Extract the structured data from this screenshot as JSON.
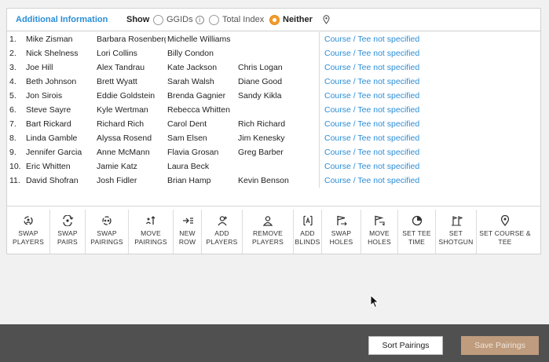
{
  "header": {
    "title": "Additional Information",
    "show_label": "Show",
    "options": [
      {
        "label": "GGIDs",
        "checked": false
      },
      {
        "label": "Total Index",
        "checked": false
      },
      {
        "label": "Neither",
        "checked": true
      }
    ]
  },
  "pairings": [
    {
      "num": "1.",
      "p1": "Mike Zisman",
      "p2": "Barbara Rosenberg",
      "p3": "Michelle Williams",
      "p4": "",
      "course": "Course / Tee not specified"
    },
    {
      "num": "2.",
      "p1": "Nick Shelness",
      "p2": "Lori Collins",
      "p3": "Billy Condon",
      "p4": "",
      "course": "Course / Tee not specified"
    },
    {
      "num": "3.",
      "p1": "Joe Hill",
      "p2": "Alex Tandrau",
      "p3": "Kate Jackson",
      "p4": "Chris Logan",
      "course": "Course / Tee not specified"
    },
    {
      "num": "4.",
      "p1": "Beth Johnson",
      "p2": "Brett Wyatt",
      "p3": "Sarah Walsh",
      "p4": "Diane Good",
      "course": "Course / Tee not specified"
    },
    {
      "num": "5.",
      "p1": "Jon Sirois",
      "p2": "Eddie Goldstein",
      "p3": "Brenda Gagnier",
      "p4": "Sandy Kikla",
      "course": "Course / Tee not specified"
    },
    {
      "num": "6.",
      "p1": "Steve Sayre",
      "p2": "Kyle Wertman",
      "p3": "Rebecca Whitten",
      "p4": "",
      "course": "Course / Tee not specified"
    },
    {
      "num": "7.",
      "p1": "Bart Rickard",
      "p2": "Richard Rich",
      "p3": "Carol Dent",
      "p4": "Rich Richard",
      "course": "Course / Tee not specified"
    },
    {
      "num": "8.",
      "p1": "Linda Gamble",
      "p2": "Alyssa Rosend",
      "p3": "Sam Elsen",
      "p4": "Jim Kenesky",
      "course": "Course / Tee not specified"
    },
    {
      "num": "9.",
      "p1": "Jennifer Garcia",
      "p2": "Anne McMann",
      "p3": "Flavia Grosan",
      "p4": "Greg Barber",
      "course": "Course / Tee not specified"
    },
    {
      "num": "10.",
      "p1": "Eric Whitten",
      "p2": "Jamie Katz",
      "p3": "Laura Beck",
      "p4": "",
      "course": "Course / Tee not specified"
    },
    {
      "num": "11.",
      "p1": "David Shofran",
      "p2": "Josh Fidler",
      "p3": "Brian Hamp",
      "p4": "Kevin Benson",
      "course": "Course / Tee not specified"
    }
  ],
  "toolbar": [
    {
      "id": "swap-players",
      "icon": "swap-players-icon",
      "l1": "SWAP",
      "l2": "PLAYERS"
    },
    {
      "id": "swap-pairs",
      "icon": "swap-pairs-icon",
      "l1": "SWAP",
      "l2": "PAIRS"
    },
    {
      "id": "swap-pairings",
      "icon": "swap-pairings-icon",
      "l1": "SWAP",
      "l2": "PAIRINGS"
    },
    {
      "id": "move-pairings",
      "icon": "move-pairings-icon",
      "l1": "MOVE",
      "l2": "PAIRINGS"
    },
    {
      "id": "new-row",
      "icon": "new-row-icon",
      "l1": "NEW",
      "l2": "ROW"
    },
    {
      "id": "add-players",
      "icon": "add-player-icon",
      "l1": "ADD",
      "l2": "PLAYERS"
    },
    {
      "id": "remove-players",
      "icon": "remove-player-icon",
      "l1": "REMOVE",
      "l2": "PLAYERS"
    },
    {
      "id": "add-blinds",
      "icon": "add-blind-icon",
      "l1": "ADD",
      "l2": "BLINDS"
    },
    {
      "id": "swap-holes",
      "icon": "swap-holes-icon",
      "l1": "SWAP",
      "l2": "HOLES"
    },
    {
      "id": "move-holes",
      "icon": "move-holes-icon",
      "l1": "MOVE",
      "l2": "HOLES"
    },
    {
      "id": "set-tee-time",
      "icon": "clock-icon",
      "l1": "SET TEE",
      "l2": "TIME"
    },
    {
      "id": "set-shotgun",
      "icon": "shotgun-flags-icon",
      "l1": "SET",
      "l2": "SHOTGUN"
    },
    {
      "id": "set-course-tee",
      "icon": "map-pin-icon",
      "l1": "SET COURSE &",
      "l2": "TEE"
    }
  ],
  "footer": {
    "sort_label": "Sort Pairings",
    "save_label": "Save Pairings"
  },
  "colors": {
    "accent_blue": "#2b8ed6",
    "radio_selected": "#f39a2b",
    "footer_bg": "#505050",
    "save_disabled": "#bf9c7d"
  }
}
